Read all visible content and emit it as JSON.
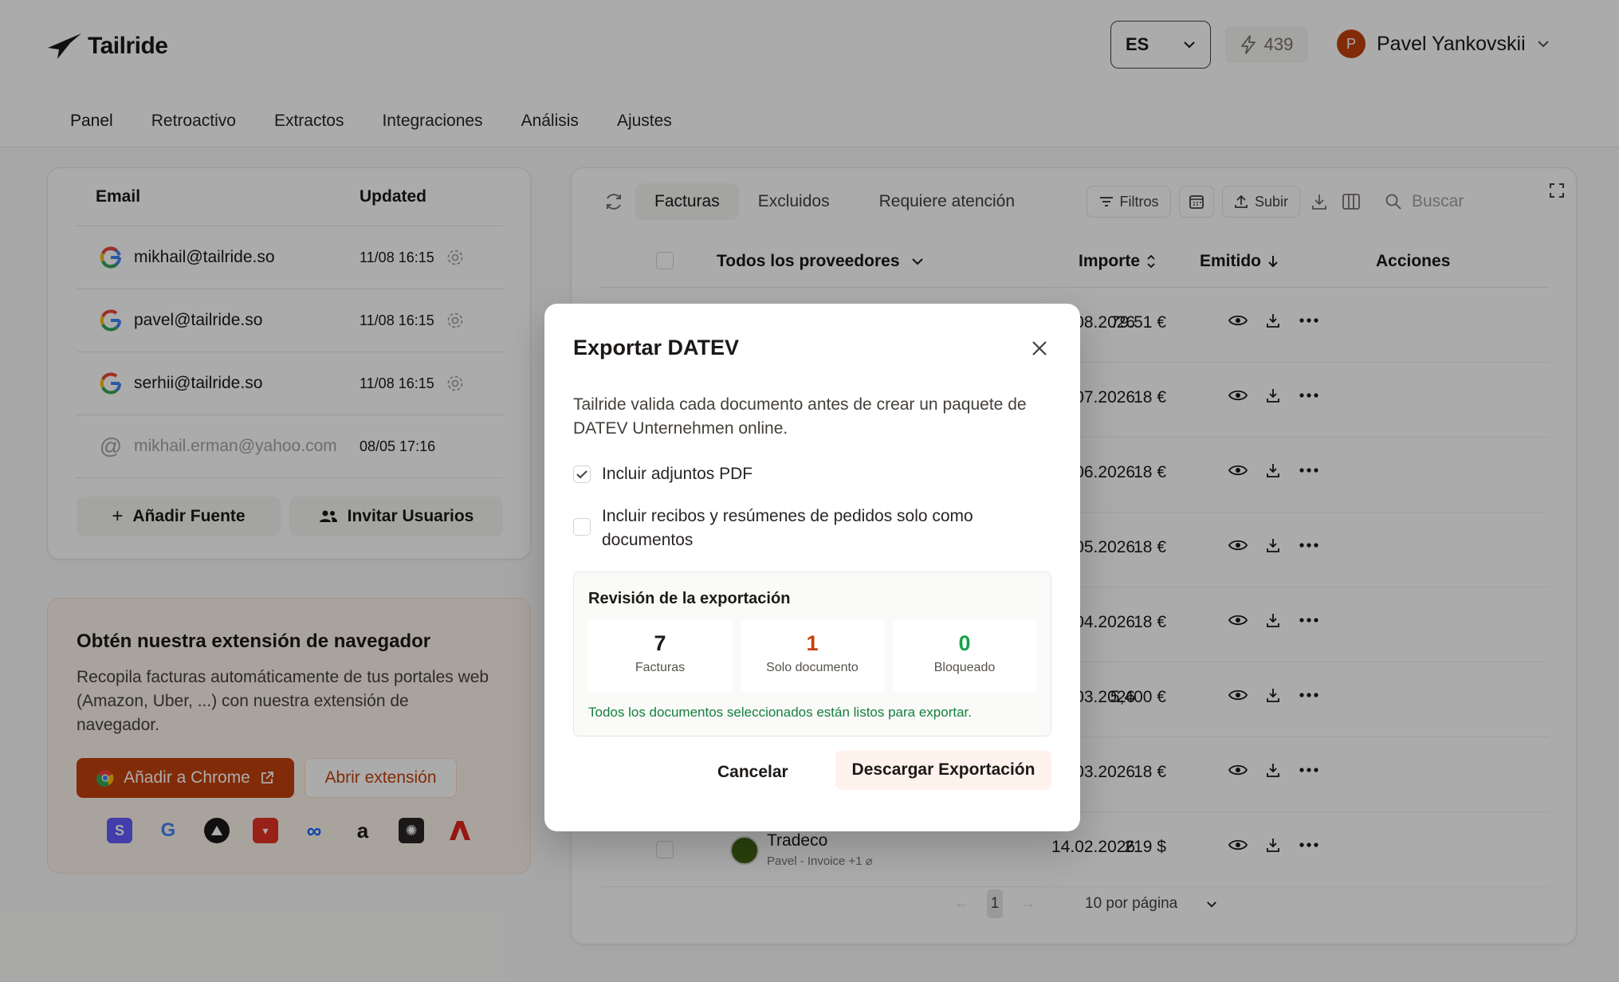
{
  "app": {
    "name": "Tailride"
  },
  "header": {
    "language": "ES",
    "credits": "439",
    "user_initial": "P",
    "user_name": "Pavel Yankovskii"
  },
  "nav": {
    "tabs": [
      "Panel",
      "Retroactivo",
      "Extractos",
      "Integraciones",
      "Análisis",
      "Ajustes"
    ],
    "active": "Panel"
  },
  "email_sources": {
    "columns": {
      "email": "Email",
      "updated": "Updated"
    },
    "rows": [
      {
        "email": "mikhail@tailride.so",
        "updated": "11/08 16:15",
        "type": "google"
      },
      {
        "email": "pavel@tailride.so",
        "updated": "11/08 16:15",
        "type": "google"
      },
      {
        "email": "serhii@tailride.so",
        "updated": "11/08 16:15",
        "type": "google"
      },
      {
        "email": "mikhail.erman@yahoo.com",
        "updated": "08/05 17:16",
        "type": "at"
      }
    ],
    "add_source": "Añadir Fuente",
    "invite_users": "Invitar Usuarios"
  },
  "extension": {
    "title": "Obtén nuestra extensión de navegador",
    "description": "Recopila facturas automáticamente de tus portales web (Amazon, Uber, ...) con nuestra extensión de navegador.",
    "add_chrome": "Añadir a Chrome",
    "open_extension": "Abrir extensión",
    "icon_names": [
      "stripe-icon",
      "google-icon",
      "vercel-icon",
      "aliexpress-icon",
      "meta-icon",
      "amazon-icon",
      "openai-icon",
      "adobe-icon"
    ]
  },
  "invoices": {
    "tabs": [
      "Facturas",
      "Excluidos",
      "Requiere atención"
    ],
    "active_tab": "Facturas",
    "filters": "Filtros",
    "upload": "Subir",
    "search_placeholder": "Buscar",
    "columns": {
      "vendor": "Todos los proveedores",
      "amount": "Importe",
      "issued": "Emitido",
      "actions": "Acciones"
    },
    "rows": [
      {
        "amount": "79.51 €",
        "date": "05.08.2026"
      },
      {
        "amount": "18 €",
        "date": "23.07.2026"
      },
      {
        "amount": "18 €",
        "date": "23.06.2026"
      },
      {
        "amount": "18 €",
        "date": "23.05.2026"
      },
      {
        "amount": "18 €",
        "date": "23.04.2026"
      },
      {
        "amount": "5,400 €",
        "date": "28.03.2026"
      },
      {
        "amount": "18 €",
        "date": "23.03.2026"
      },
      {
        "amount": "219 $",
        "date": "14.02.2026",
        "vendor": "Tradeco",
        "meta": "Pavel - Invoice +1"
      }
    ],
    "pager": {
      "prev": "←",
      "page": "1",
      "next": "→",
      "per_page": "10 por página"
    }
  },
  "modal": {
    "title": "Exportar DATEV",
    "description": "Tailride valida cada documento antes de crear un paquete de DATEV Unternehmen online.",
    "include_pdf": "Incluir adjuntos PDF",
    "include_pdf_checked": true,
    "include_receipts": "Incluir recibos y resúmenes de pedidos solo como documentos",
    "include_receipts_checked": false,
    "review": {
      "title": "Revisión de la exportación",
      "stats": [
        {
          "value": "7",
          "label": "Facturas",
          "color": "#1c1917"
        },
        {
          "value": "1",
          "label": "Solo documento",
          "color": "#c2410c"
        },
        {
          "value": "0",
          "label": "Bloqueado",
          "color": "#16a34a"
        }
      ],
      "message": "Todos los documentos seleccionados están listos para exportar."
    },
    "cancel": "Cancelar",
    "download": "Descargar Exportación"
  }
}
